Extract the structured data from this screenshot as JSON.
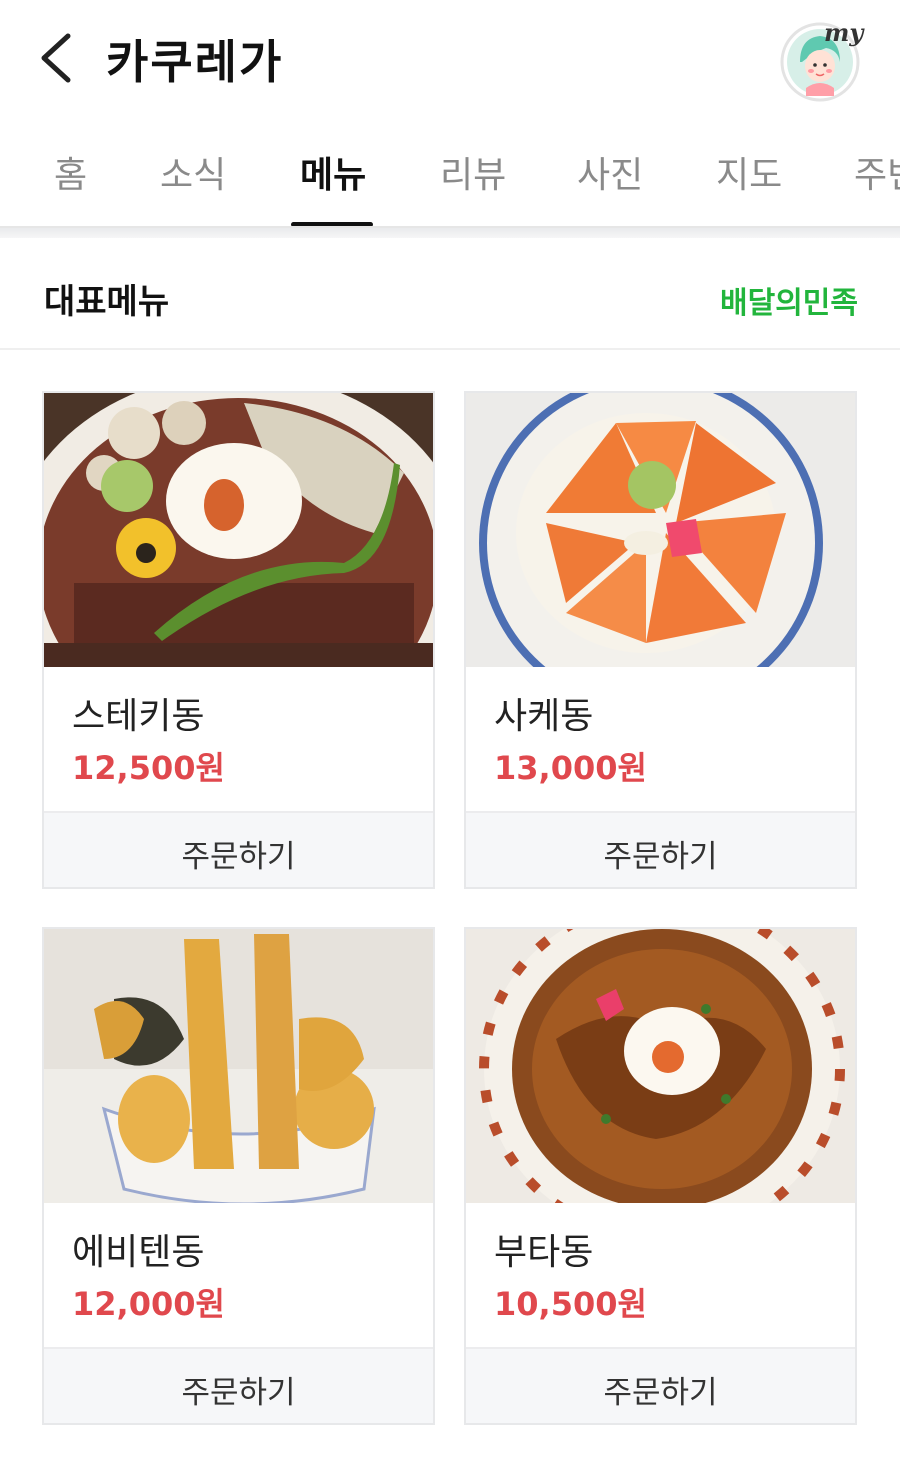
{
  "header": {
    "title": "카쿠레가",
    "avatar_label": "my"
  },
  "tabs": [
    {
      "label": "홈"
    },
    {
      "label": "소식"
    },
    {
      "label": "메뉴"
    },
    {
      "label": "리뷰"
    },
    {
      "label": "사진"
    },
    {
      "label": "지도"
    },
    {
      "label": "주변"
    }
  ],
  "section": {
    "title": "대표메뉴",
    "link_label": "배달의민족"
  },
  "menu": [
    {
      "name": "스테키동",
      "price": "12,500원",
      "order_label": "주문하기"
    },
    {
      "name": "사케동",
      "price": "13,000원",
      "order_label": "주문하기"
    },
    {
      "name": "에비텐동",
      "price": "12,000원",
      "order_label": "주문하기"
    },
    {
      "name": "부타동",
      "price": "10,500원",
      "order_label": "주문하기"
    }
  ],
  "colors": {
    "accent_green": "#22b53c",
    "price_red": "#e0484d",
    "active_tab": "#111111",
    "inactive_tab": "#8a8a8a"
  },
  "icons": [
    "back-chevron-icon",
    "my-avatar-icon"
  ]
}
